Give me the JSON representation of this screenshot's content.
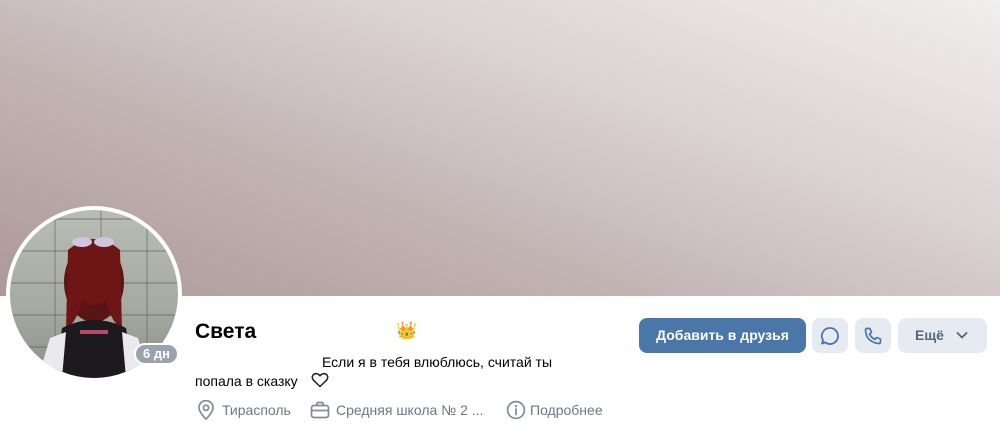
{
  "profile": {
    "name": "Света",
    "status_badge": "6 дн",
    "bio_line1": "Если я в тебя влюблюсь, считай ты",
    "bio_line2": "попала в сказку",
    "emoji": "👑"
  },
  "info": {
    "city": "Тирасполь",
    "school": "Средняя школа № 2 ...",
    "details": "Подробнее"
  },
  "actions": {
    "add_friend": "Добавить в друзья",
    "more": "Ещё"
  },
  "colors": {
    "primary_button": "#4a76a8",
    "secondary_button": "#e5ebf1",
    "muted_text": "#6d7885"
  },
  "icons": [
    "location-pin-icon",
    "briefcase-icon",
    "info-icon",
    "message-icon",
    "phone-icon",
    "chevron-down-icon",
    "heart-icon",
    "crown-emoji"
  ]
}
